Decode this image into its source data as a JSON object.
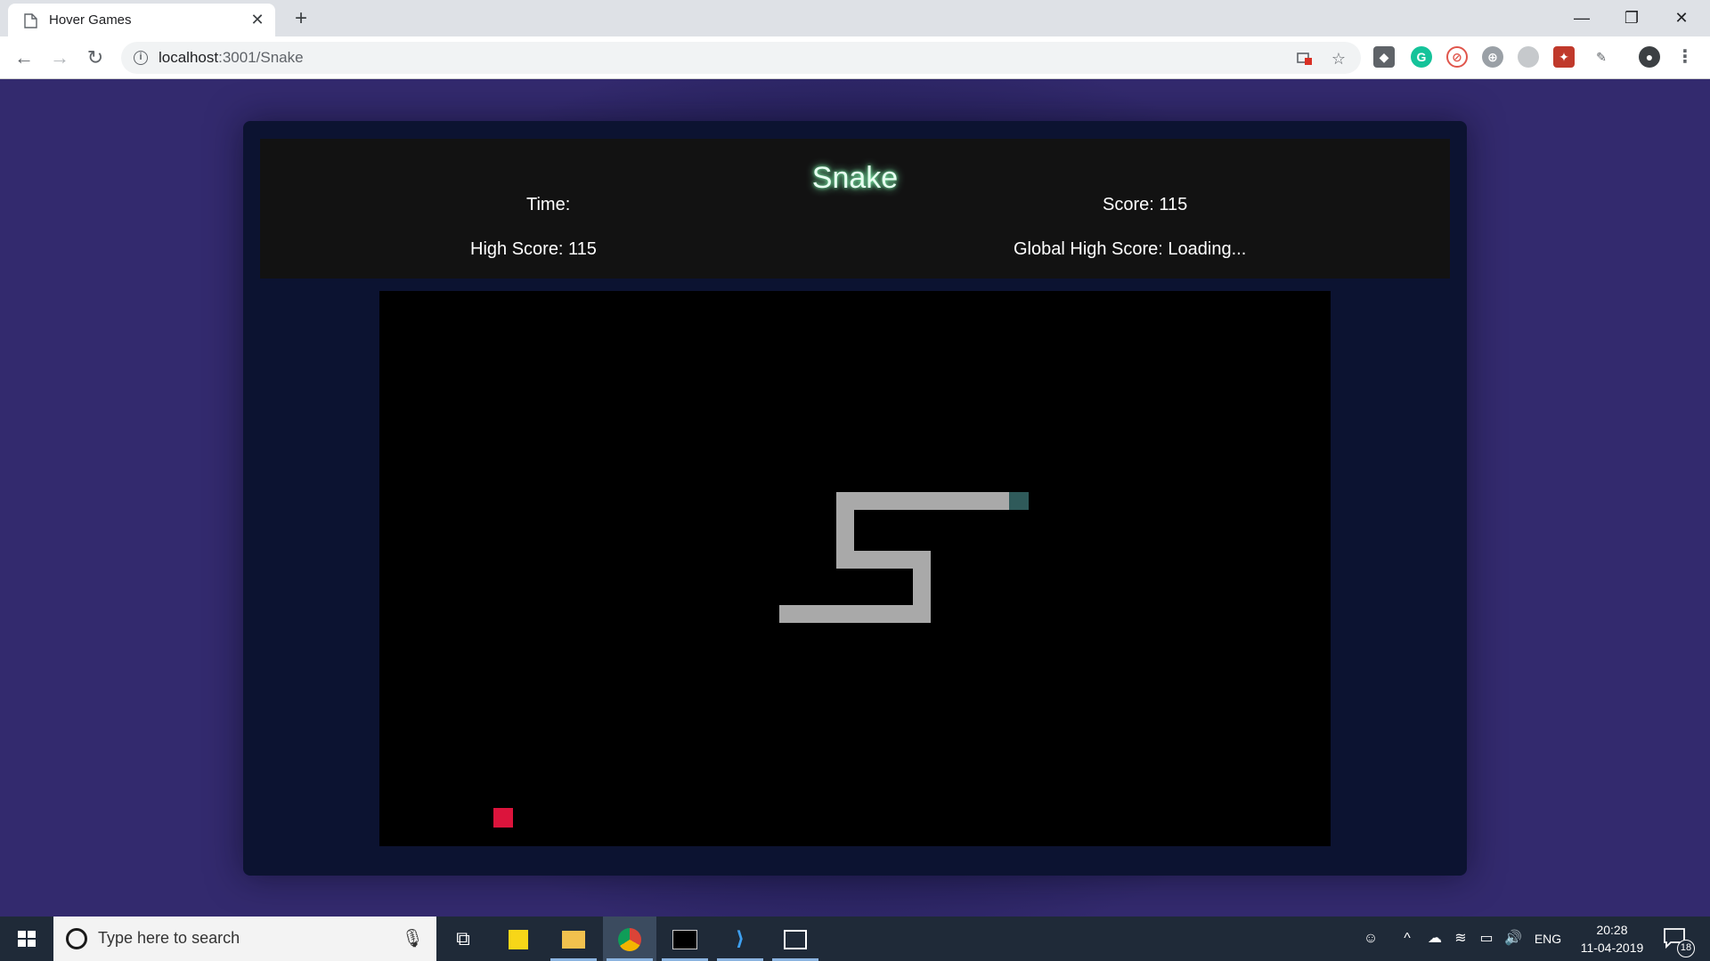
{
  "browser": {
    "tab_title": "Hover Games",
    "tab_close": "✕",
    "new_tab": "+",
    "url_host": "localhost",
    "url_path": ":3001/Snake",
    "window_controls": {
      "minimize": "—",
      "restore": "❐",
      "close": "✕"
    },
    "nav": {
      "back": "←",
      "forward": "→",
      "reload": "↻"
    }
  },
  "game": {
    "title": "Snake",
    "time_label": "Time:",
    "score_label": "Score: 115",
    "high_score_label": "High Score: 115",
    "global_high_score_label": "Global High Score: Loading...",
    "colors": {
      "snake_body": "#a9a9a9",
      "snake_head": "#2f5a5a",
      "food": "#dc143c",
      "board": "#000000"
    }
  },
  "taskbar": {
    "search_placeholder": "Type here to search",
    "language": "ENG",
    "time": "20:28",
    "date": "11-04-2019",
    "notification_count": "18"
  }
}
